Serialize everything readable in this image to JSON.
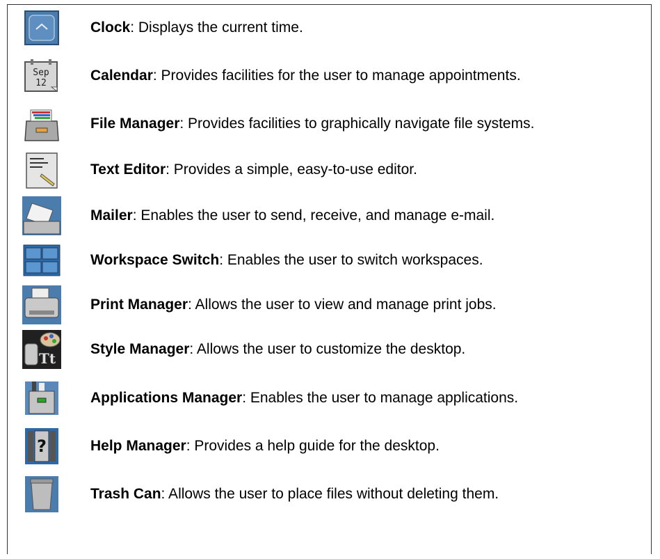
{
  "items": [
    {
      "icon": "clock-icon",
      "name": "Clock",
      "desc": ": Displays the current time."
    },
    {
      "icon": "calendar-icon",
      "name": "Calendar",
      "desc": ": Provides facilities for the user to manage appointments.",
      "icon_text_1": "Sep",
      "icon_text_2": "12"
    },
    {
      "icon": "file-manager-icon",
      "name": "File Manager",
      "desc": ": Provides facilities to graphically navigate file systems."
    },
    {
      "icon": "text-editor-icon",
      "name": "Text Editor",
      "desc": ": Provides a simple, easy-to-use editor."
    },
    {
      "icon": "mailer-icon",
      "name": "Mailer",
      "desc": ": Enables the user to send, receive, and manage e-mail."
    },
    {
      "icon": "workspace-switch-icon",
      "name": "Workspace Switch",
      "desc": ": Enables the user to switch workspaces."
    },
    {
      "icon": "print-manager-icon",
      "name": "Print Manager",
      "desc": ": Allows the user to view and manage print jobs."
    },
    {
      "icon": "style-manager-icon",
      "name": "Style Manager",
      "desc": ": Allows the user to customize the desktop."
    },
    {
      "icon": "applications-manager-icon",
      "name": "Applications Manager",
      "desc": ": Enables the user to manage applications."
    },
    {
      "icon": "help-manager-icon",
      "name": "Help Manager",
      "desc": ": Provides a help guide for the desktop.",
      "icon_text_1": "?"
    },
    {
      "icon": "trash-can-icon",
      "name": "Trash Can",
      "desc": ": Allows the user to place files without deleting them."
    }
  ]
}
